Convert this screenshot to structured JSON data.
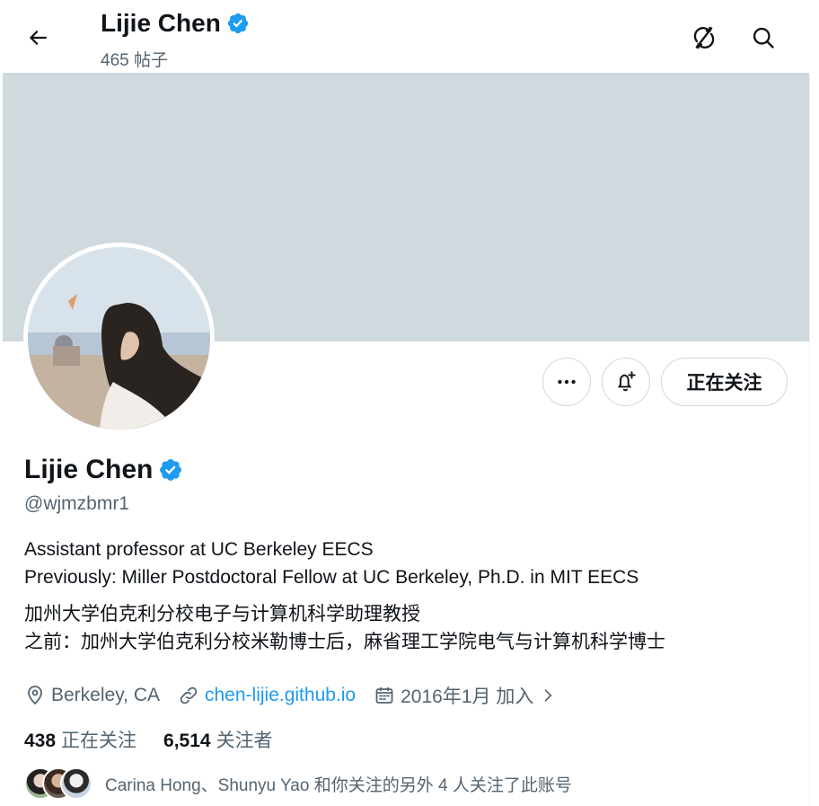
{
  "header": {
    "name": "Lijie Chen",
    "posts": "465 帖子"
  },
  "profile": {
    "name": "Lijie Chen",
    "handle": "@wjmzbmr1",
    "bio_lines": [
      "Assistant professor at UC Berkeley EECS",
      "Previously: Miller Postdoctoral Fellow at UC Berkeley, Ph.D. in MIT EECS",
      "加州大学伯克利分校电子与计算机科学助理教授",
      "之前：加州大学伯克利分校米勒博士后，麻省理工学院电气与计算机科学博士"
    ],
    "location": "Berkeley, CA",
    "website": "chen-lijie.github.io",
    "joined": "2016年1月 加入",
    "following_count": "438",
    "following_label": "正在关注",
    "followers_count": "6,514",
    "followers_label": "关注者",
    "followed_by": "Carina Hong、Shunyu Yao 和你关注的另外 4 人关注了此账号"
  },
  "actions": {
    "follow_label": "正在关注"
  },
  "icons": {
    "back": "arrow-left-icon",
    "sync": "sync-off-icon",
    "search": "search-icon",
    "verified": "verified-badge-icon",
    "more": "more-icon",
    "notify": "bell-plus-icon",
    "location": "location-pin-icon",
    "link": "link-icon",
    "calendar": "calendar-icon",
    "chevron": "chevron-right-icon"
  },
  "colors": {
    "accent": "#1d9bf0",
    "text": "#0f1419",
    "secondary": "#536471",
    "banner": "#cfd9de"
  }
}
